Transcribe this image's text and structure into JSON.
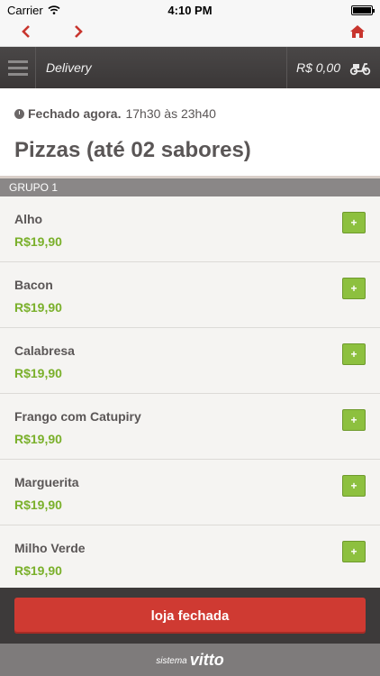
{
  "status_bar": {
    "carrier": "Carrier",
    "time": "4:10 PM"
  },
  "nav": {
    "back_icon": "chevron-left",
    "forward_icon": "chevron-right",
    "home_icon": "home"
  },
  "header": {
    "title": "Delivery",
    "cart_total": "R$ 0,00",
    "cart_icon": "scooter"
  },
  "store": {
    "status": "Fechado agora.",
    "hours": "17h30 às 23h40"
  },
  "page": {
    "title": "Pizzas (até 02 sabores)"
  },
  "group": {
    "label": "GRUPO 1"
  },
  "products": [
    {
      "name": "Alho",
      "price": "R$19,90",
      "add_label": "+"
    },
    {
      "name": "Bacon",
      "price": "R$19,90",
      "add_label": "+"
    },
    {
      "name": "Calabresa",
      "price": "R$19,90",
      "add_label": "+"
    },
    {
      "name": "Frango com Catupiry",
      "price": "R$19,90",
      "add_label": "+"
    },
    {
      "name": "Marguerita",
      "price": "R$19,90",
      "add_label": "+"
    },
    {
      "name": "Milho Verde",
      "price": "R$19,90",
      "add_label": "+"
    }
  ],
  "actions": {
    "closed_label": "loja fechada"
  },
  "footer": {
    "prefix": "sistema",
    "brand": "vitto"
  },
  "colors": {
    "accent_red": "#cf3a32",
    "price_green": "#7ab02b",
    "header_dark": "#3d3a3a"
  }
}
